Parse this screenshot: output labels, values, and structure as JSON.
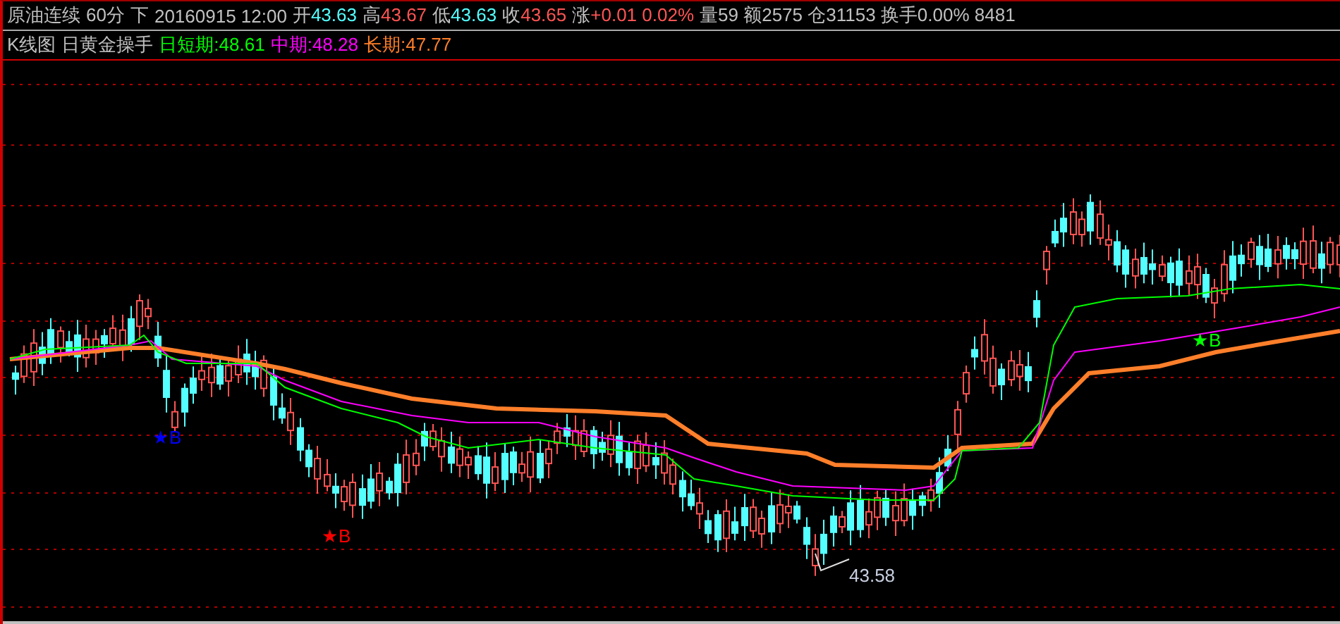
{
  "quote_bar": {
    "symbol": "原油连续",
    "period": "60分",
    "mode": "下",
    "datetime": "20160915 12:00",
    "fields": [
      {
        "label": "开",
        "value": "43.63",
        "color": "#54ffff"
      },
      {
        "label": "高",
        "value": "43.67",
        "color": "#ff5454"
      },
      {
        "label": "低",
        "value": "43.63",
        "color": "#54ffff"
      },
      {
        "label": "收",
        "value": "43.65",
        "color": "#ff5454"
      },
      {
        "label": "涨",
        "value": "+0.01 0.02%",
        "color": "#ff5454"
      }
    ],
    "stats": "量59 额2575 仓31153 换手0.00% 8481"
  },
  "indicator_bar": {
    "chart_name": "K线图",
    "indicator": "日黄金操手",
    "lines": [
      {
        "label": "日短期:48.61",
        "color": "#00ff00"
      },
      {
        "label": "中期:48.28",
        "color": "#ff00ff"
      },
      {
        "label": "长期:47.77",
        "color": "#ff7f2a"
      }
    ]
  },
  "markers": [
    {
      "label": "★B",
      "color": "#0000ff"
    },
    {
      "label": "★B",
      "color": "#ff0000"
    },
    {
      "label": "★B",
      "color": "#00ff00"
    }
  ],
  "low_label": "43.58"
}
